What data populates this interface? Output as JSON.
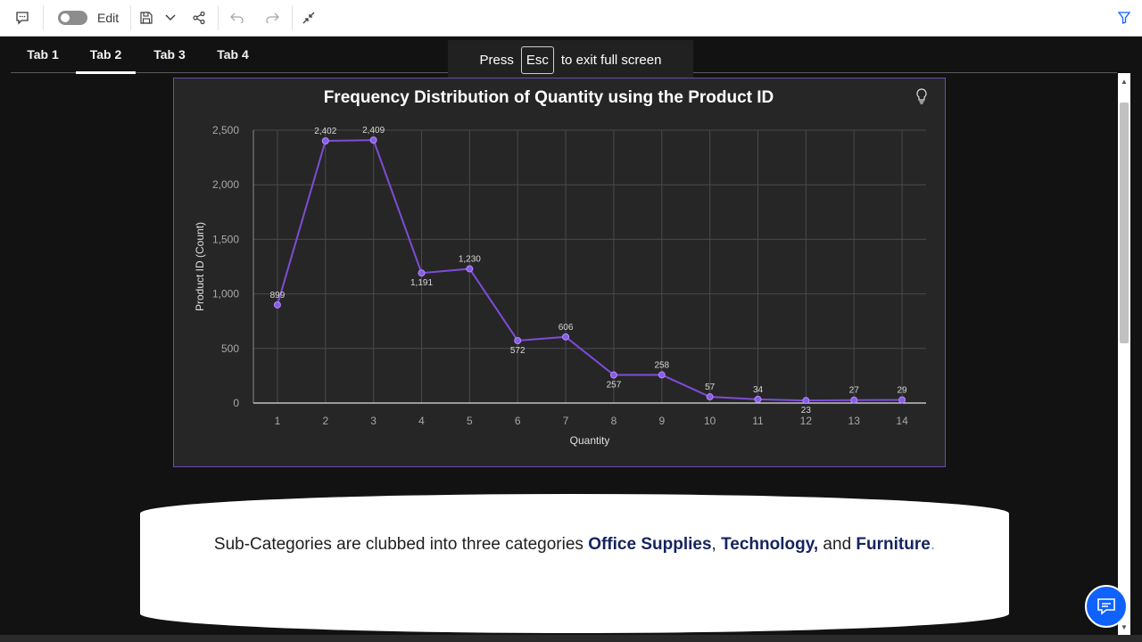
{
  "toolbar": {
    "comment_icon": "comment-icon",
    "edit_label": "Edit",
    "edit_toggle_on": false,
    "save_icon": "save-icon",
    "dropdown_icon": "chevron-down-icon",
    "share_icon": "share-icon",
    "undo_icon": "undo-icon",
    "redo_icon": "redo-icon",
    "exit_fullscreen_icon": "collapse-icon",
    "filter_icon": "filter-icon"
  },
  "tabs": [
    {
      "label": "Tab 1",
      "active": false
    },
    {
      "label": "Tab 2",
      "active": true
    },
    {
      "label": "Tab 3",
      "active": false
    },
    {
      "label": "Tab 4",
      "active": false
    }
  ],
  "toast": {
    "prefix": "Press",
    "key": "Esc",
    "suffix": "to exit full screen"
  },
  "chart_data": {
    "type": "line",
    "title": "Frequency Distribution of Quantity using the Product ID",
    "xlabel": "Quantity",
    "ylabel": "Product ID (Count)",
    "x": [
      1,
      2,
      3,
      4,
      5,
      6,
      7,
      8,
      9,
      10,
      11,
      12,
      13,
      14
    ],
    "values": [
      899,
      2402,
      2409,
      1191,
      1230,
      572,
      606,
      257,
      258,
      57,
      34,
      23,
      27,
      29
    ],
    "data_labels": [
      "899",
      "2,402",
      "2,409",
      "1,191",
      "1,230",
      "572",
      "606",
      "257",
      "258",
      "57",
      "34",
      "23",
      "27",
      "29"
    ],
    "ylim": [
      0,
      2500
    ],
    "yticks": [
      0,
      500,
      1000,
      1500,
      2000,
      2500
    ],
    "ytick_labels": [
      "0",
      "500",
      "1,000",
      "1,500",
      "2,000",
      "2,500"
    ],
    "grid": true,
    "colors": {
      "line": "#7c4dd6",
      "marker": "#8a5ce6",
      "background": "#262626",
      "grid": "#4a4a4a"
    }
  },
  "chart_icons": {
    "insight_icon": "lightbulb-icon"
  },
  "note": {
    "text_before": "Sub-Categories are clubbed into three categories ",
    "cat1": "Office Supplies",
    "sep1": ", ",
    "cat2": "Technology,",
    "sep2": " and ",
    "cat3": "Furniture",
    "end": "."
  },
  "chat_icon": "chat-icon"
}
